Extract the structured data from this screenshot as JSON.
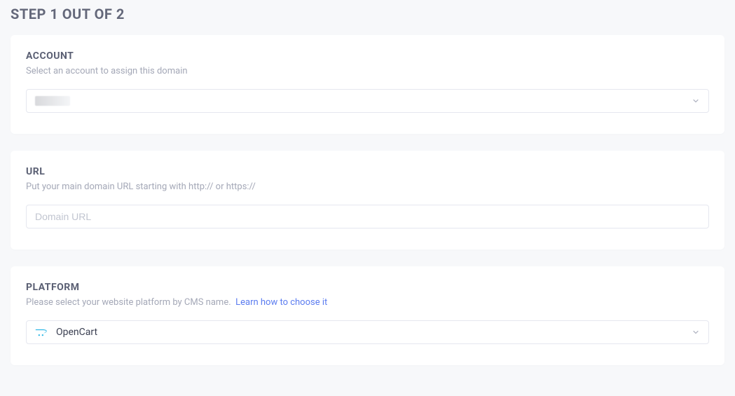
{
  "header": {
    "step_title": "STEP 1 OUT OF 2"
  },
  "account": {
    "title": "ACCOUNT",
    "subtitle": "Select an account to assign this domain",
    "selected": ""
  },
  "url": {
    "title": "URL",
    "subtitle": "Put your main domain URL starting with http:// or https://",
    "placeholder": "Domain URL",
    "value": ""
  },
  "platform": {
    "title": "PLATFORM",
    "subtitle_prefix": "Please select your website platform by CMS name.",
    "learn_link": "Learn how to choose it",
    "selected": "OpenCart"
  }
}
